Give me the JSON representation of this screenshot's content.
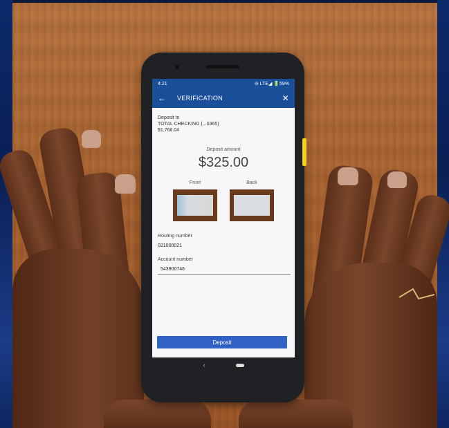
{
  "status_bar": {
    "time": "4:21",
    "indicators": "⊖ LTE◢ 🔋59%"
  },
  "app_bar": {
    "back_icon": "←",
    "title": "VERIFICATION",
    "close_icon": "✕"
  },
  "deposit_to": {
    "label": "Deposit to",
    "account": "TOTAL CHECKING (...0365)",
    "balance": "$1,768.04"
  },
  "deposit_amount": {
    "label": "Deposit amount",
    "value": "$325.00"
  },
  "check_images": {
    "front_label": "Front",
    "back_label": "Back"
  },
  "routing": {
    "label": "Routing number",
    "value": "021000021"
  },
  "account": {
    "label": "Account number",
    "value": "543900746"
  },
  "deposit_button": {
    "label": "Deposit"
  },
  "nav": {
    "back_glyph": "‹"
  }
}
